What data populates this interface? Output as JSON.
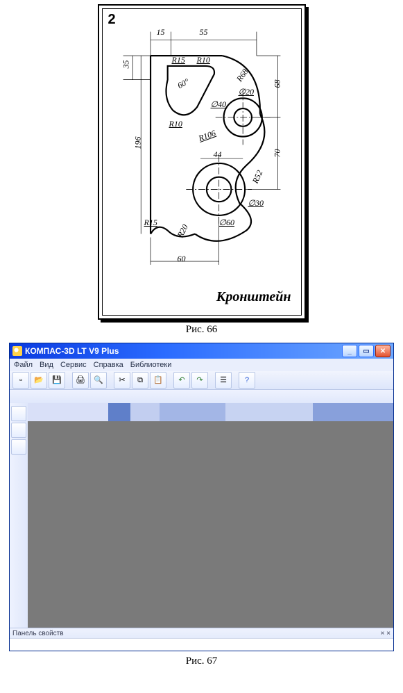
{
  "fig66": {
    "variant": "2",
    "part_name": "Кронштейн",
    "caption": "Рис. 66",
    "dims": {
      "d15": "15",
      "d55": "55",
      "d35_v": "35",
      "r15_top": "R15",
      "r10_top": "R10",
      "a60": "60°",
      "r68": "R68",
      "dia20": "∅20",
      "d68_v": "68",
      "dia40": "∅40",
      "r10_mid": "R10",
      "r106": "R106",
      "d196": "196",
      "d44": "44",
      "d70_v": "70",
      "r52": "R52",
      "dia30": "∅30",
      "dia60": "∅60",
      "r15_bot": "R15",
      "r20": "R20",
      "d60_bot": "60"
    }
  },
  "fig67": {
    "caption": "Рис. 67",
    "window_title": "КОМПАС-3D LT V9 Plus",
    "menu": [
      "Файл",
      "Вид",
      "Сервис",
      "Справка",
      "Библиотеки"
    ],
    "status_left": "Панель свойств",
    "status_pin": "× ×",
    "toolbar_icons": [
      "new-icon",
      "open-icon",
      "save-icon",
      "sep",
      "print-icon",
      "preview-icon",
      "sep",
      "cut-icon",
      "copy-icon",
      "paste-icon",
      "sep",
      "undo-icon",
      "redo-icon",
      "sep",
      "properties-icon",
      "sep",
      "help-icon"
    ],
    "sidebar_icons": [
      "sb1",
      "sb2",
      "sb3"
    ],
    "winbtns": {
      "min": "_",
      "max": "▭",
      "close": "✕"
    },
    "canvas_top_segments": [
      {
        "w": "22%",
        "c": "#d9e0f8"
      },
      {
        "w": "6%",
        "c": "#5f7fc9"
      },
      {
        "w": "8%",
        "c": "#c2cef0"
      },
      {
        "w": "18%",
        "c": "#a3b6e6"
      },
      {
        "w": "24%",
        "c": "#c7d3f2"
      },
      {
        "w": "22%",
        "c": "#88a0db"
      }
    ]
  }
}
